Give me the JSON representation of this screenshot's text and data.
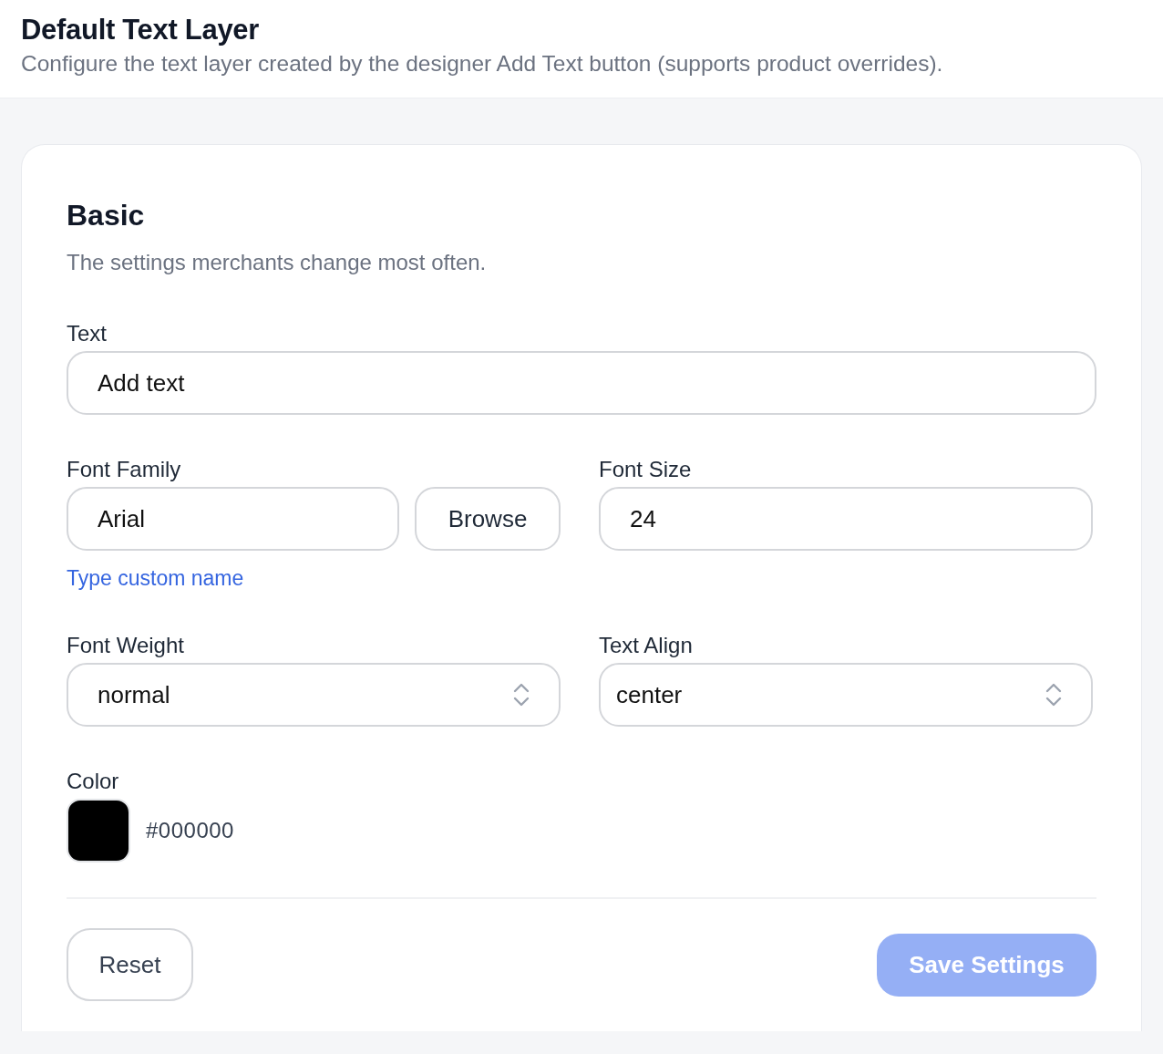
{
  "header": {
    "title": "Default Text Layer",
    "subtitle": "Configure the text layer created by the designer Add Text button (supports product overrides)."
  },
  "section": {
    "title": "Basic",
    "description": "The settings merchants change most often."
  },
  "text_field": {
    "label": "Text",
    "value": "Add text"
  },
  "font_family": {
    "label": "Font Family",
    "value": "Arial",
    "browse_button": "Browse",
    "link": "Type custom name"
  },
  "font_size": {
    "label": "Font Size",
    "value": "24"
  },
  "font_weight": {
    "label": "Font Weight",
    "value": "normal"
  },
  "text_align": {
    "label": "Text Align",
    "value": "center"
  },
  "color": {
    "label": "Color",
    "color": "#000000",
    "value": "#000000"
  },
  "footer": {
    "reset_button": "Reset",
    "save_button": {
      "label": "Save Settings",
      "disabled": true
    }
  }
}
